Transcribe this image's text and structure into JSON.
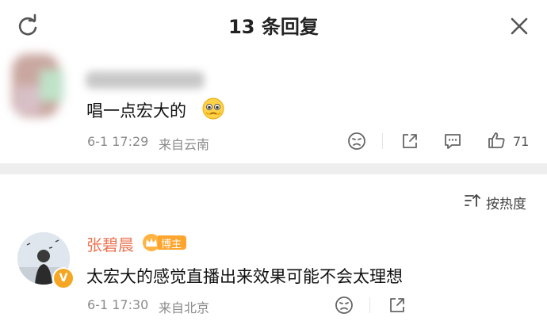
{
  "header": {
    "title": "13 条回复",
    "refresh_icon": "refresh-icon",
    "close_icon": "close-icon"
  },
  "comments": [
    {
      "text": "唱一点宏大的",
      "emoji": "pleading-emoji",
      "time": "6-1 17:29",
      "source": "来自云南",
      "likes": "71"
    },
    {
      "author": "张碧晨",
      "badge": "博主",
      "text": "太宏大的感觉直播出来效果可能不会太理想",
      "time": "6-1 17:30",
      "source": "来自北京",
      "verified_mark": "V"
    }
  ],
  "sort": {
    "label": "按热度"
  },
  "colors": {
    "author": "#eb7350",
    "badge": "#ffa52e",
    "meta": "#8a8a8a"
  }
}
